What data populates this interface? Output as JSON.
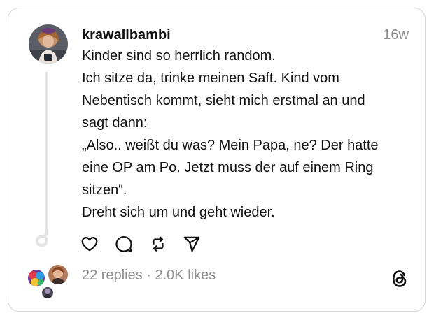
{
  "post": {
    "username": "krawallbambi",
    "timestamp": "16w",
    "lines": [
      "Kinder sind so herrlich random.",
      "Ich sitze da, trinke meinen Saft. Kind vom",
      "Nebentisch kommt, sieht mich erstmal an und",
      "sagt dann:",
      "„Also.. weißt du was? Mein Papa, ne? Der hatte",
      "eine OP am Po. Jetzt muss der auf einem Ring",
      "sitzen“.",
      "Dreht sich um und geht wieder."
    ]
  },
  "stats": {
    "text": "22 replies · 2.0K likes"
  },
  "actions": [
    {
      "icon": "heart-icon"
    },
    {
      "icon": "comment-icon"
    },
    {
      "icon": "repost-icon"
    },
    {
      "icon": "share-icon"
    }
  ],
  "colors": {
    "text": "#111111",
    "muted": "#8e8e8e",
    "border": "#d6d6d6",
    "thread_line": "#e3e3e3"
  }
}
